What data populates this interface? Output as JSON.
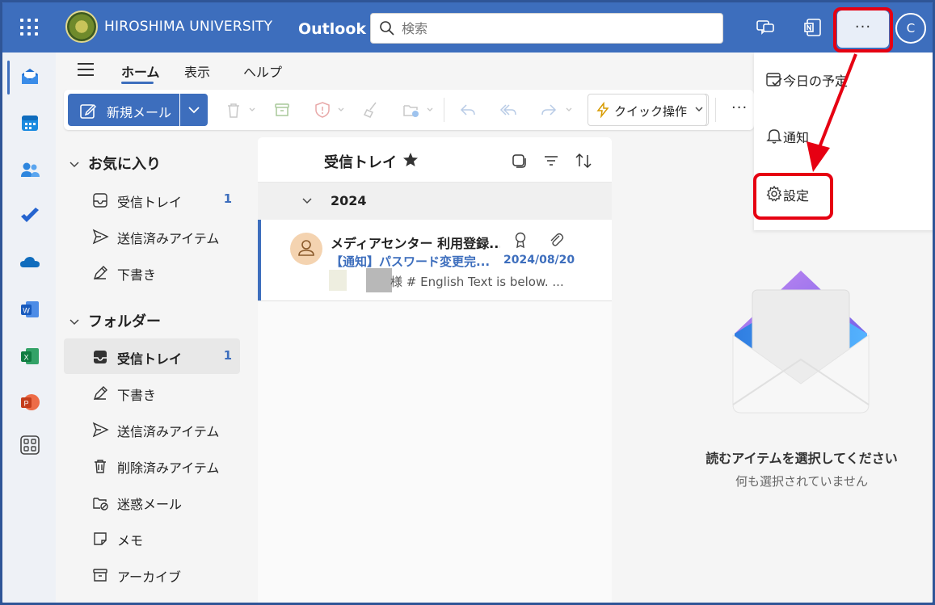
{
  "header": {
    "university_name": "HIROSHIMA UNIVERSITY",
    "app_name": "Outlook",
    "search_placeholder": "検索",
    "more_label": "···",
    "avatar_initial": "C"
  },
  "ribbon": {
    "tabs": [
      {
        "label": "ホーム",
        "active": true
      },
      {
        "label": "表示",
        "active": false
      },
      {
        "label": "ヘルプ",
        "active": false
      }
    ],
    "new_mail_label": "新規メール",
    "quick_action_label": "クイック操作",
    "more_label": "···"
  },
  "folders": {
    "favorites_label": "お気に入り",
    "favorites": [
      {
        "label": "受信トレイ",
        "count": "1",
        "icon": "inbox-icon"
      },
      {
        "label": "送信済みアイテム",
        "count": "",
        "icon": "send-icon"
      },
      {
        "label": "下書き",
        "count": "",
        "icon": "draft-icon"
      }
    ],
    "folders_label": "フォルダー",
    "items": [
      {
        "label": "受信トレイ",
        "count": "1",
        "icon": "inbox-icon",
        "active": true
      },
      {
        "label": "下書き",
        "count": "",
        "icon": "draft-icon"
      },
      {
        "label": "送信済みアイテム",
        "count": "",
        "icon": "send-icon"
      },
      {
        "label": "削除済みアイテム",
        "count": "",
        "icon": "trash-icon"
      },
      {
        "label": "迷惑メール",
        "count": "",
        "icon": "junk-icon"
      },
      {
        "label": "メモ",
        "count": "",
        "icon": "note-icon"
      },
      {
        "label": "アーカイブ",
        "count": "",
        "icon": "archive-icon"
      }
    ]
  },
  "message_list": {
    "title": "受信トレイ",
    "group_label": "2024",
    "messages": [
      {
        "sender": "メディアセンター 利用登録...",
        "subject": "【通知】パスワード変更完...",
        "date": "2024/08/20",
        "preview": "様 # English Text is below. ..."
      }
    ]
  },
  "reading_pane": {
    "title": "読むアイテムを選択してください",
    "subtitle": "何も選択されていません"
  },
  "menu": {
    "items": [
      {
        "label": "今日の予定",
        "icon": "calendar-check-icon"
      },
      {
        "label": "通知",
        "icon": "bell-icon"
      },
      {
        "label": "設定",
        "icon": "gear-icon"
      }
    ]
  },
  "colors": {
    "brand": "#3d6ebd",
    "highlight": "#e60012"
  }
}
